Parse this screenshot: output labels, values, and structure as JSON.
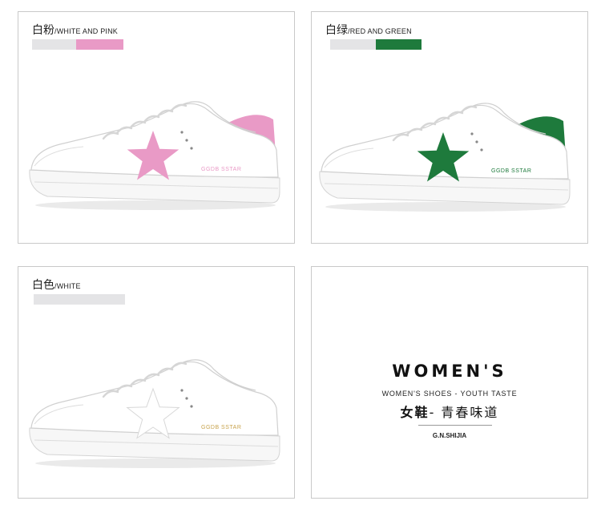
{
  "panels": [
    {
      "label_cn": "白粉",
      "label_en": "/WHITE AND PINK",
      "accent": "#e99ac6",
      "shoe_text": "GGDB SSTAR"
    },
    {
      "label_cn": "白绿",
      "label_en": "/RED AND GREEN",
      "accent": "#1e7a3c",
      "shoe_text": "GGDB SSTAR"
    },
    {
      "label_cn": "白色",
      "label_en": "/WHITE",
      "accent": "#e4e4e6",
      "shoe_text": "GGDB SSTAR"
    }
  ],
  "swatch_base": "#e4e4e6",
  "brand": {
    "title": "WOMEN'S",
    "subtitle": "WOMEN'S SHOES - YOUTH TASTE",
    "cn_bold": "女鞋",
    "cn_rest": "- 青春味道",
    "mark": "G.N.SHIJIA"
  }
}
